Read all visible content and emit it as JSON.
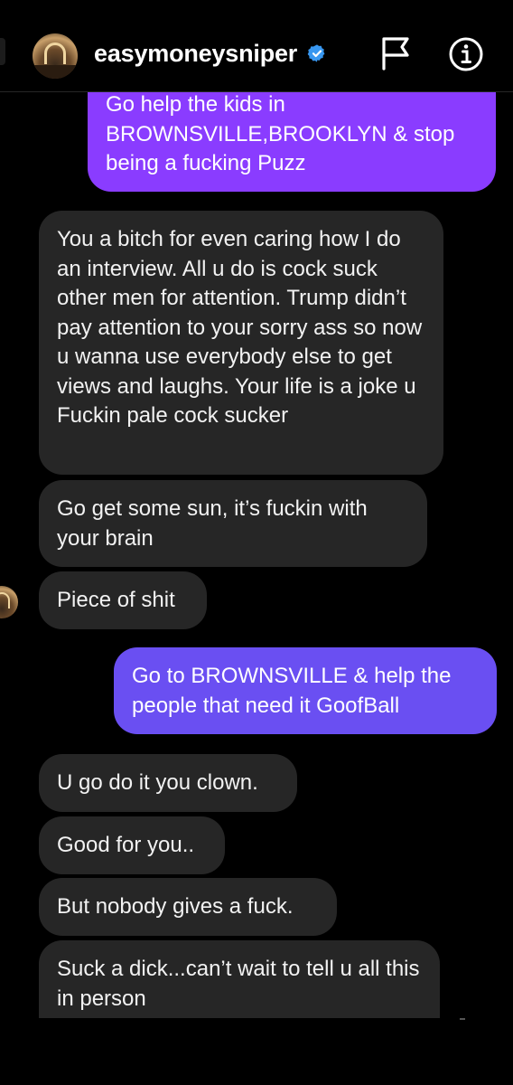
{
  "header": {
    "username": "easymoneysniper",
    "verified_icon": "verified-badge-icon",
    "flag_icon": "flag-icon",
    "info_icon": "info-icon",
    "verified_color": "#3897f0"
  },
  "messages": [
    {
      "from": "me",
      "text": "Go help the kids in BROWNSVILLE,BROOKLYN & stop being a fucking Puzz"
    },
    {
      "from": "them",
      "text": "You a bitch for even caring how I do an interview. All u do is cock suck other men for attention. Trump didn’t pay attention to your sorry ass so now u wanna use everybody else to get views and laughs. Your life is a joke u Fuckin pale cock sucker"
    },
    {
      "from": "them",
      "text": "Go get some sun, it’s fuckin with your brain"
    },
    {
      "from": "them",
      "text": "Piece of shit"
    },
    {
      "from": "me",
      "text": "Go to BROWNSVILLE & help the people that need it GoofBall"
    },
    {
      "from": "them",
      "text": "U go do it you clown."
    },
    {
      "from": "them",
      "text": "Good for you.."
    },
    {
      "from": "them",
      "text": "But nobody gives a fuck."
    },
    {
      "from": "them",
      "text": "Suck a dick...can’t wait to tell u all this in person"
    }
  ],
  "colors": {
    "background": "#000000",
    "incoming_bubble": "#262626",
    "outgoing_bubble_top": "#8a3cff",
    "outgoing_bubble_bottom": "#6a4ff2"
  }
}
